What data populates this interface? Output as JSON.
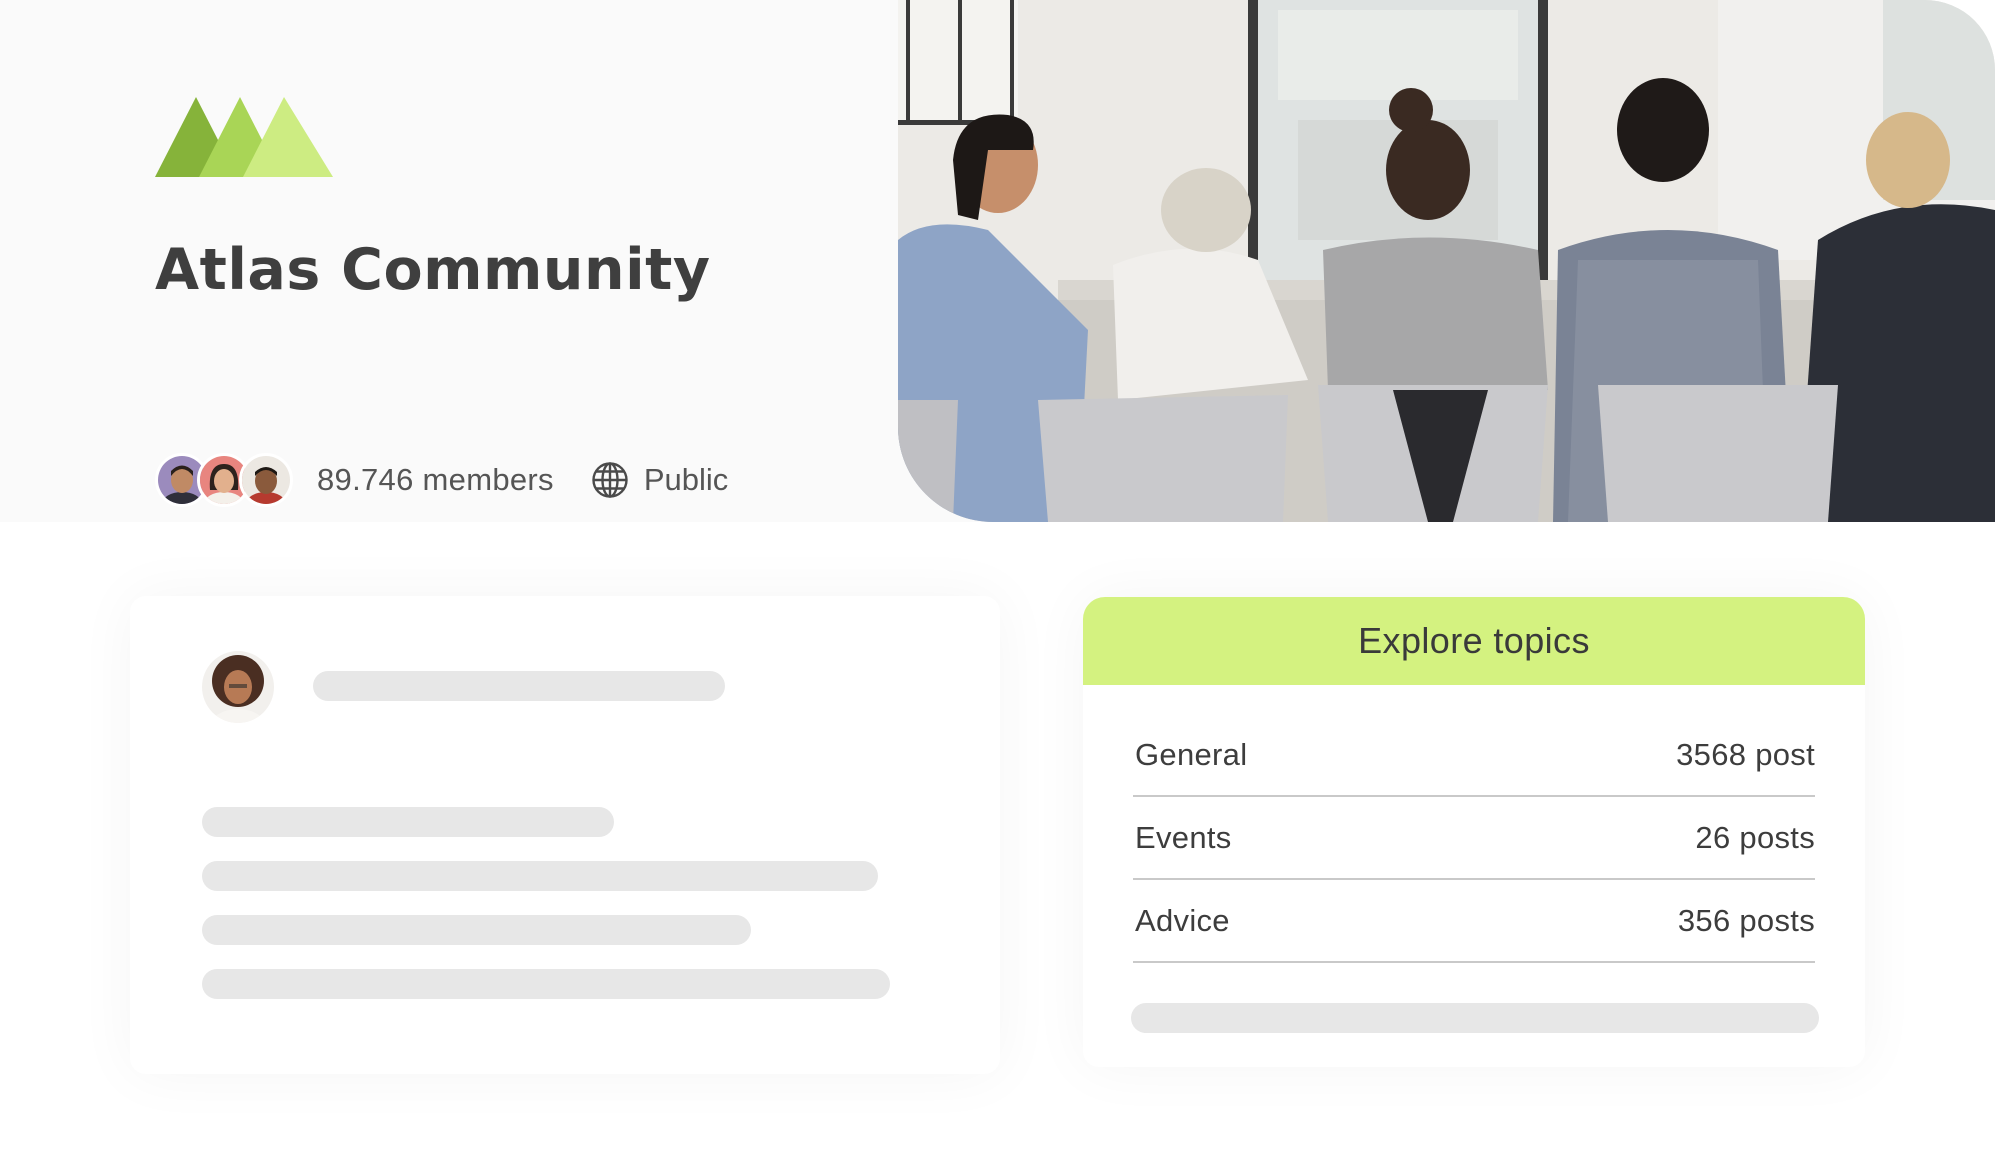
{
  "community": {
    "name": "Atlas Community",
    "members_label": "89.746 members",
    "privacy_label": "Public",
    "logo_icon": "mountains-logo",
    "privacy_icon": "globe-icon",
    "accent_color": "#d4f280",
    "logo_colors": [
      "#86b33a",
      "#a9d556",
      "#cdec82"
    ]
  },
  "topics": {
    "title": "Explore topics",
    "items": [
      {
        "name": "General",
        "count": "3568 post"
      },
      {
        "name": "Events",
        "count": "26 posts"
      },
      {
        "name": "Advice",
        "count": "356 posts"
      }
    ]
  }
}
